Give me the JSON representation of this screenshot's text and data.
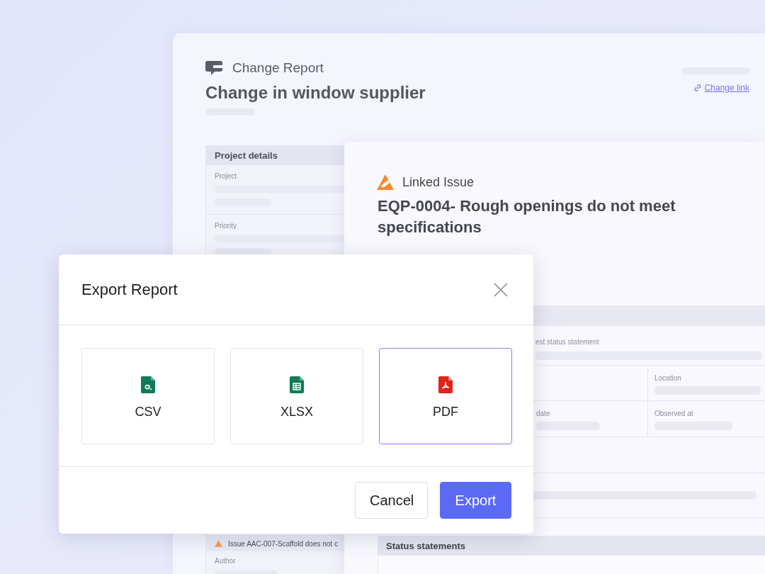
{
  "report": {
    "type_label": "Change Report",
    "title": "Change in window supplier",
    "link": "Change link",
    "details_heading": "Project details",
    "fields": [
      "Project",
      "Priority"
    ],
    "linked_row": "Issue AAC-007-Scaffold does not c",
    "author_label": "Author"
  },
  "linked_issue": {
    "type_label": "Linked Issue",
    "title": "EQP-0004- Rough openings do not meet specifications",
    "status_label": "est status statement",
    "fields": [
      {
        "label": "Location"
      },
      {
        "label": "date"
      },
      {
        "label": "Observed at"
      }
    ],
    "section": "Status statements"
  },
  "dialog": {
    "title": "Export Report",
    "options": [
      {
        "kind": "csv",
        "label": "CSV",
        "selected": false
      },
      {
        "kind": "xlsx",
        "label": "XLSX",
        "selected": false
      },
      {
        "kind": "pdf",
        "label": "PDF",
        "selected": true
      }
    ],
    "buttons": [
      {
        "kind": "secondary",
        "label": "Cancel"
      },
      {
        "kind": "primary",
        "label": "Export"
      }
    ]
  }
}
